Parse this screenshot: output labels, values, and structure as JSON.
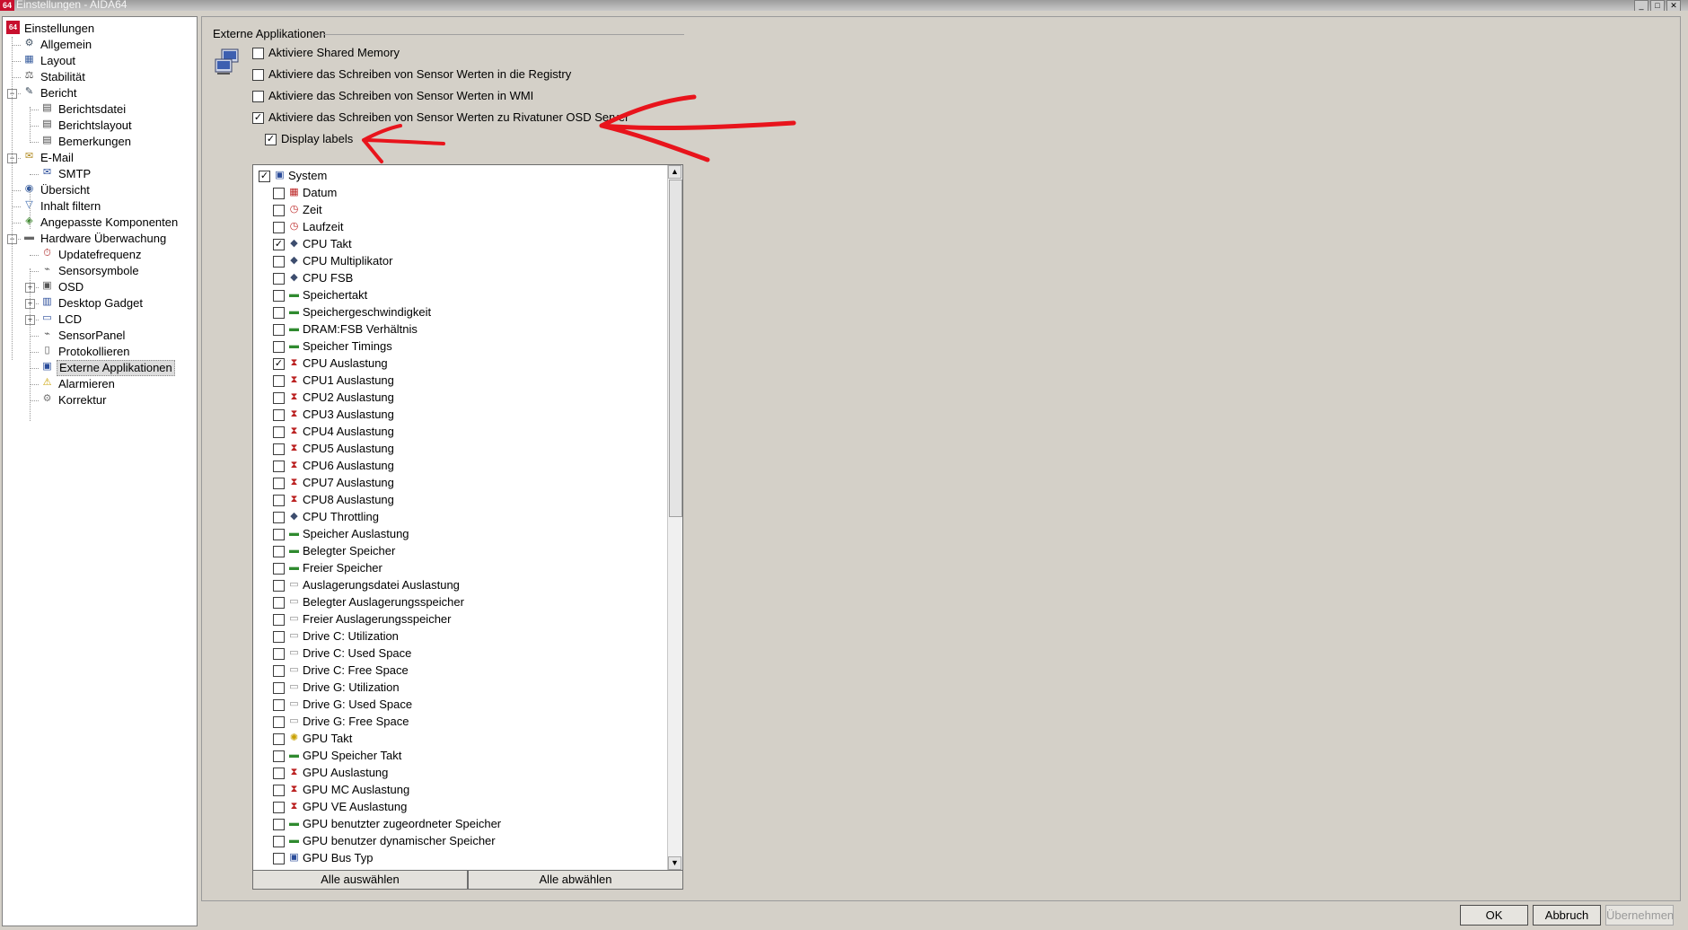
{
  "window": {
    "title": "Einstellungen - AIDA64",
    "app_icon_text": "64",
    "minimize": "_",
    "maximize": "□",
    "close": "✕"
  },
  "tree": [
    {
      "label": "Einstellungen",
      "icon": "aida64-icon",
      "level": 0
    },
    {
      "label": "Allgemein",
      "icon": "settings-icon",
      "level": 1
    },
    {
      "label": "Layout",
      "icon": "layout-icon",
      "level": 1
    },
    {
      "label": "Stabilität",
      "icon": "stability-icon",
      "level": 1
    },
    {
      "label": "Bericht",
      "icon": "report-icon",
      "level": 1,
      "expanded": true
    },
    {
      "label": "Berichtsdatei",
      "icon": "document-icon",
      "level": 2
    },
    {
      "label": "Berichtslayout",
      "icon": "document-icon",
      "level": 2
    },
    {
      "label": "Bemerkungen",
      "icon": "document-icon",
      "level": 2
    },
    {
      "label": "E-Mail",
      "icon": "email-icon",
      "level": 1,
      "expanded": true
    },
    {
      "label": "SMTP",
      "icon": "smtp-icon",
      "level": 2
    },
    {
      "label": "Übersicht",
      "icon": "overview-icon",
      "level": 1
    },
    {
      "label": "Inhalt filtern",
      "icon": "filter-icon",
      "level": 1
    },
    {
      "label": "Angepasste Komponenten",
      "icon": "components-icon",
      "level": 1
    },
    {
      "label": "Hardware Überwachung",
      "icon": "hardware-icon",
      "level": 1,
      "expanded": true
    },
    {
      "label": "Updatefrequenz",
      "icon": "update-icon",
      "level": 2
    },
    {
      "label": "Sensorsymbole",
      "icon": "sensor-icon",
      "level": 2
    },
    {
      "label": "OSD",
      "icon": "osd-icon",
      "level": 2,
      "collapsed": true
    },
    {
      "label": "Desktop Gadget",
      "icon": "gadget-icon",
      "level": 2,
      "collapsed": true
    },
    {
      "label": "LCD",
      "icon": "lcd-icon",
      "level": 2,
      "collapsed": true
    },
    {
      "label": "SensorPanel",
      "icon": "sensorpanel-icon",
      "level": 2
    },
    {
      "label": "Protokollieren",
      "icon": "log-icon",
      "level": 2
    },
    {
      "label": "Externe Applikationen",
      "icon": "external-apps-icon",
      "level": 2,
      "selected": true
    },
    {
      "label": "Alarmieren",
      "icon": "warning-icon",
      "level": 2
    },
    {
      "label": "Korrektur",
      "icon": "correction-icon",
      "level": 2
    }
  ],
  "group_title": "Externe Applikationen",
  "options": [
    {
      "label": "Aktiviere Shared Memory",
      "checked": false
    },
    {
      "label": "Aktiviere das Schreiben von Sensor Werten in die Registry",
      "checked": false
    },
    {
      "label": "Aktiviere das Schreiben von Sensor Werten in WMI",
      "checked": false
    },
    {
      "label": "Aktiviere das Schreiben von Sensor Werten zu Rivatuner OSD Server",
      "checked": true
    },
    {
      "label": "Display labels",
      "checked": true
    }
  ],
  "sensor_root": {
    "label": "System",
    "checked": true,
    "icon": "system-icon"
  },
  "sensors": [
    {
      "label": "Datum",
      "checked": false,
      "icon": "calendar-icon"
    },
    {
      "label": "Zeit",
      "checked": false,
      "icon": "clock-icon"
    },
    {
      "label": "Laufzeit",
      "checked": false,
      "icon": "clock-icon"
    },
    {
      "label": "CPU Takt",
      "checked": true,
      "icon": "cpu-icon"
    },
    {
      "label": "CPU Multiplikator",
      "checked": false,
      "icon": "cpu-icon"
    },
    {
      "label": "CPU FSB",
      "checked": false,
      "icon": "cpu-icon"
    },
    {
      "label": "Speichertakt",
      "checked": false,
      "icon": "memory-icon"
    },
    {
      "label": "Speichergeschwindigkeit",
      "checked": false,
      "icon": "memory-icon"
    },
    {
      "label": "DRAM:FSB Verhältnis",
      "checked": false,
      "icon": "memory-icon"
    },
    {
      "label": "Speicher Timings",
      "checked": false,
      "icon": "memory-icon"
    },
    {
      "label": "CPU Auslastung",
      "checked": true,
      "icon": "hourglass-icon"
    },
    {
      "label": "CPU1 Auslastung",
      "checked": false,
      "icon": "hourglass-icon"
    },
    {
      "label": "CPU2 Auslastung",
      "checked": false,
      "icon": "hourglass-icon"
    },
    {
      "label": "CPU3 Auslastung",
      "checked": false,
      "icon": "hourglass-icon"
    },
    {
      "label": "CPU4 Auslastung",
      "checked": false,
      "icon": "hourglass-icon"
    },
    {
      "label": "CPU5 Auslastung",
      "checked": false,
      "icon": "hourglass-icon"
    },
    {
      "label": "CPU6 Auslastung",
      "checked": false,
      "icon": "hourglass-icon"
    },
    {
      "label": "CPU7 Auslastung",
      "checked": false,
      "icon": "hourglass-icon"
    },
    {
      "label": "CPU8 Auslastung",
      "checked": false,
      "icon": "hourglass-icon"
    },
    {
      "label": "CPU Throttling",
      "checked": false,
      "icon": "cpu-icon"
    },
    {
      "label": "Speicher Auslastung",
      "checked": false,
      "icon": "memory-icon"
    },
    {
      "label": "Belegter Speicher",
      "checked": false,
      "icon": "memory-icon"
    },
    {
      "label": "Freier Speicher",
      "checked": false,
      "icon": "memory-icon"
    },
    {
      "label": "Auslagerungsdatei Auslastung",
      "checked": false,
      "icon": "drive-icon"
    },
    {
      "label": "Belegter Auslagerungsspeicher",
      "checked": false,
      "icon": "drive-icon"
    },
    {
      "label": "Freier Auslagerungsspeicher",
      "checked": false,
      "icon": "drive-icon"
    },
    {
      "label": "Drive C: Utilization",
      "checked": false,
      "icon": "drive-icon"
    },
    {
      "label": "Drive C: Used Space",
      "checked": false,
      "icon": "drive-icon"
    },
    {
      "label": "Drive C: Free Space",
      "checked": false,
      "icon": "drive-icon"
    },
    {
      "label": "Drive G: Utilization",
      "checked": false,
      "icon": "drive-icon"
    },
    {
      "label": "Drive G: Used Space",
      "checked": false,
      "icon": "drive-icon"
    },
    {
      "label": "Drive G: Free Space",
      "checked": false,
      "icon": "drive-icon"
    },
    {
      "label": "GPU Takt",
      "checked": false,
      "icon": "gpu-clock-icon"
    },
    {
      "label": "GPU Speicher Takt",
      "checked": false,
      "icon": "memory-icon"
    },
    {
      "label": "GPU Auslastung",
      "checked": false,
      "icon": "hourglass-icon"
    },
    {
      "label": "GPU MC Auslastung",
      "checked": false,
      "icon": "hourglass-icon"
    },
    {
      "label": "GPU VE Auslastung",
      "checked": false,
      "icon": "hourglass-icon"
    },
    {
      "label": "GPU benutzter zugeordneter Speicher",
      "checked": false,
      "icon": "memory-icon"
    },
    {
      "label": "GPU benutzer dynamischer Speicher",
      "checked": false,
      "icon": "memory-icon"
    },
    {
      "label": "GPU Bus Typ",
      "checked": false,
      "icon": "monitor-icon"
    }
  ],
  "buttons": {
    "select_all": "Alle auswählen",
    "deselect_all": "Alle abwählen",
    "ok": "OK",
    "cancel": "Abbruch",
    "apply": "Übernehmen"
  },
  "scroll": {
    "up": "▲",
    "down": "▼",
    "position": 0
  },
  "colors": {
    "dialog_bg": "#d4d0c8",
    "annotation_red": "#e8141c",
    "selected_bg": "#dcdcdc"
  }
}
